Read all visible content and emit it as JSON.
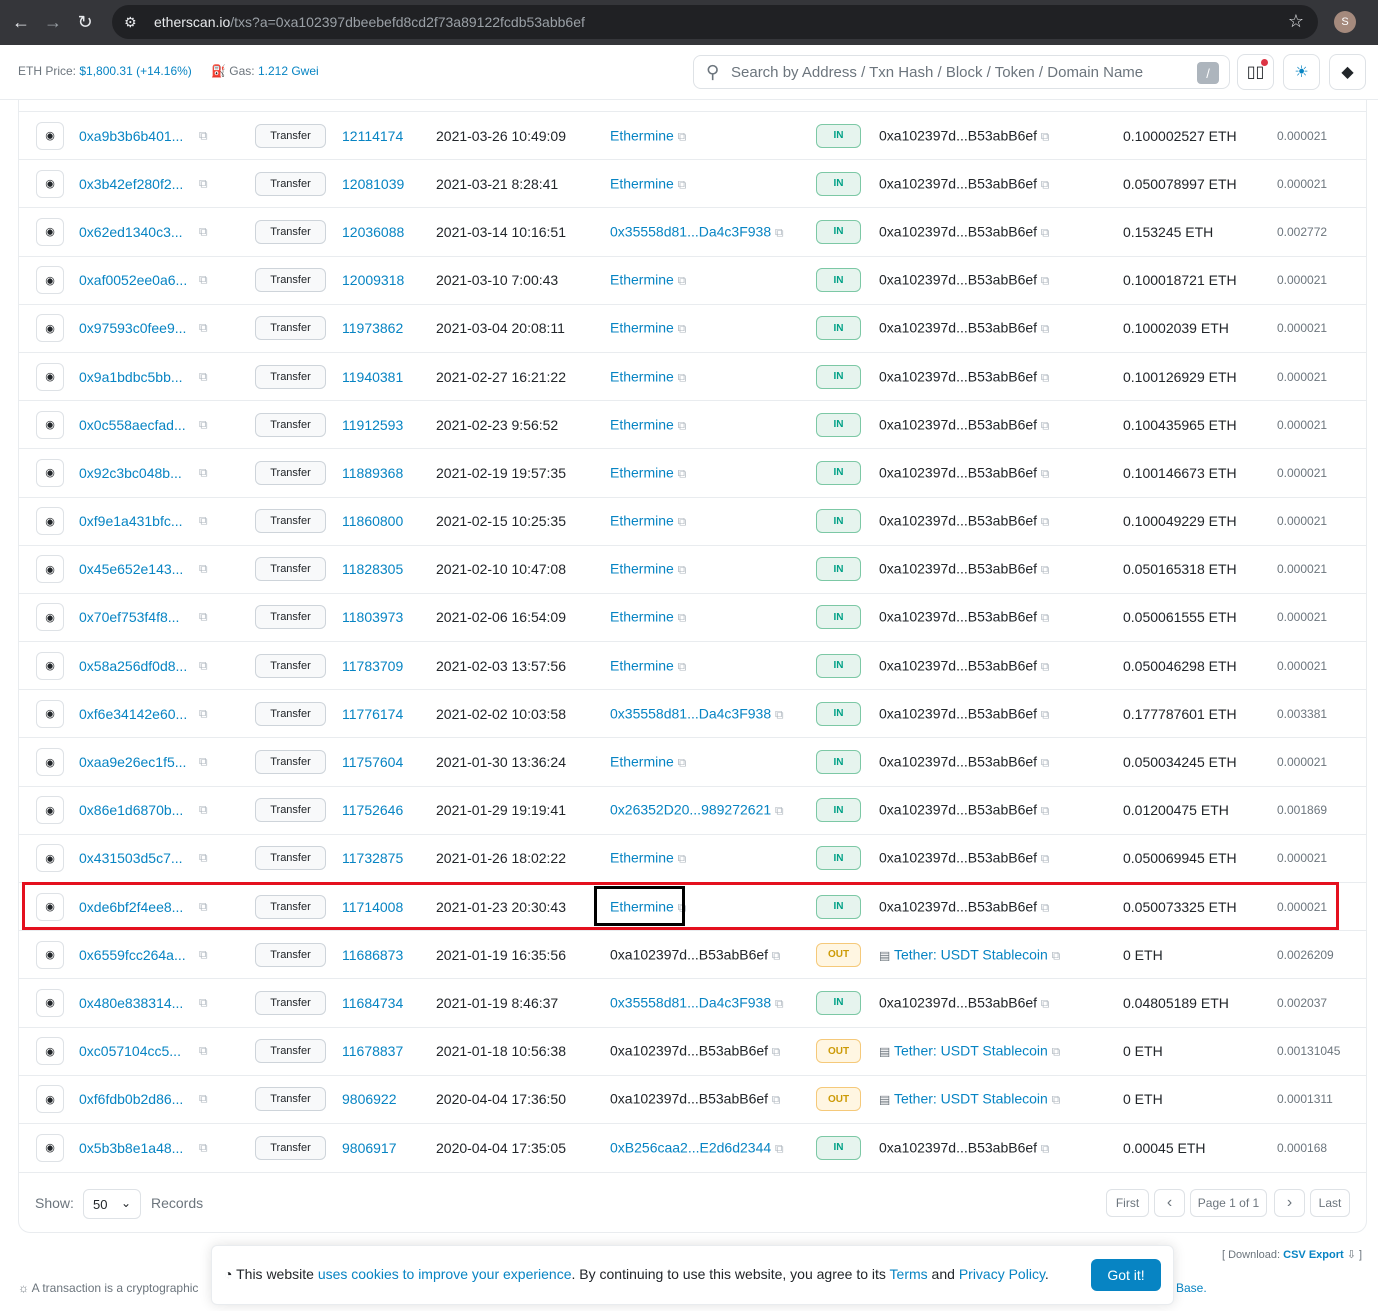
{
  "browser": {
    "url_host": "etherscan.io",
    "url_path": "/txs?a=0xa102397dbeebefd8cd2f73a89122fcdb53abb6ef",
    "profile_initial": "S"
  },
  "header": {
    "eth_price_label": "ETH Price:",
    "eth_price_value": "$1,800.31 (+14.16%)",
    "gas_label": "Gas:",
    "gas_value": "1.212 Gwei",
    "search_placeholder": "Search by Address / Txn Hash / Block / Token / Domain Name",
    "search_shortcut": "/"
  },
  "rows": [
    {
      "hash": "0xa9b3b6b401...",
      "method": "Transfer",
      "block": "12114174",
      "age": "2021-03-26 10:49:09",
      "from": "Ethermine",
      "from_link": true,
      "dir": "IN",
      "to": "0xa102397d...B53abB6ef",
      "to_link": false,
      "to_doc": false,
      "value": "0.100002527 ETH",
      "fee": "0.000021"
    },
    {
      "hash": "0x3b42ef280f2...",
      "method": "Transfer",
      "block": "12081039",
      "age": "2021-03-21 8:28:41",
      "from": "Ethermine",
      "from_link": true,
      "dir": "IN",
      "to": "0xa102397d...B53abB6ef",
      "to_link": false,
      "to_doc": false,
      "value": "0.050078997 ETH",
      "fee": "0.000021"
    },
    {
      "hash": "0x62ed1340c3...",
      "method": "Transfer",
      "block": "12036088",
      "age": "2021-03-14 10:16:51",
      "from": "0x35558d81...Da4c3F938",
      "from_link": true,
      "dir": "IN",
      "to": "0xa102397d...B53abB6ef",
      "to_link": false,
      "to_doc": false,
      "value": "0.153245 ETH",
      "fee": "0.002772"
    },
    {
      "hash": "0xaf0052ee0a6...",
      "method": "Transfer",
      "block": "12009318",
      "age": "2021-03-10 7:00:43",
      "from": "Ethermine",
      "from_link": true,
      "dir": "IN",
      "to": "0xa102397d...B53abB6ef",
      "to_link": false,
      "to_doc": false,
      "value": "0.100018721 ETH",
      "fee": "0.000021"
    },
    {
      "hash": "0x97593c0fee9...",
      "method": "Transfer",
      "block": "11973862",
      "age": "2021-03-04 20:08:11",
      "from": "Ethermine",
      "from_link": true,
      "dir": "IN",
      "to": "0xa102397d...B53abB6ef",
      "to_link": false,
      "to_doc": false,
      "value": "0.10002039 ETH",
      "fee": "0.000021"
    },
    {
      "hash": "0x9a1bdbc5bb...",
      "method": "Transfer",
      "block": "11940381",
      "age": "2021-02-27 16:21:22",
      "from": "Ethermine",
      "from_link": true,
      "dir": "IN",
      "to": "0xa102397d...B53abB6ef",
      "to_link": false,
      "to_doc": false,
      "value": "0.100126929 ETH",
      "fee": "0.000021"
    },
    {
      "hash": "0x0c558aecfad...",
      "method": "Transfer",
      "block": "11912593",
      "age": "2021-02-23 9:56:52",
      "from": "Ethermine",
      "from_link": true,
      "dir": "IN",
      "to": "0xa102397d...B53abB6ef",
      "to_link": false,
      "to_doc": false,
      "value": "0.100435965 ETH",
      "fee": "0.000021"
    },
    {
      "hash": "0x92c3bc048b...",
      "method": "Transfer",
      "block": "11889368",
      "age": "2021-02-19 19:57:35",
      "from": "Ethermine",
      "from_link": true,
      "dir": "IN",
      "to": "0xa102397d...B53abB6ef",
      "to_link": false,
      "to_doc": false,
      "value": "0.100146673 ETH",
      "fee": "0.000021"
    },
    {
      "hash": "0xf9e1a431bfc...",
      "method": "Transfer",
      "block": "11860800",
      "age": "2021-02-15 10:25:35",
      "from": "Ethermine",
      "from_link": true,
      "dir": "IN",
      "to": "0xa102397d...B53abB6ef",
      "to_link": false,
      "to_doc": false,
      "value": "0.100049229 ETH",
      "fee": "0.000021"
    },
    {
      "hash": "0x45e652e143...",
      "method": "Transfer",
      "block": "11828305",
      "age": "2021-02-10 10:47:08",
      "from": "Ethermine",
      "from_link": true,
      "dir": "IN",
      "to": "0xa102397d...B53abB6ef",
      "to_link": false,
      "to_doc": false,
      "value": "0.050165318 ETH",
      "fee": "0.000021"
    },
    {
      "hash": "0x70ef753f4f8...",
      "method": "Transfer",
      "block": "11803973",
      "age": "2021-02-06 16:54:09",
      "from": "Ethermine",
      "from_link": true,
      "dir": "IN",
      "to": "0xa102397d...B53abB6ef",
      "to_link": false,
      "to_doc": false,
      "value": "0.050061555 ETH",
      "fee": "0.000021"
    },
    {
      "hash": "0x58a256df0d8...",
      "method": "Transfer",
      "block": "11783709",
      "age": "2021-02-03 13:57:56",
      "from": "Ethermine",
      "from_link": true,
      "dir": "IN",
      "to": "0xa102397d...B53abB6ef",
      "to_link": false,
      "to_doc": false,
      "value": "0.050046298 ETH",
      "fee": "0.000021"
    },
    {
      "hash": "0xf6e34142e60...",
      "method": "Transfer",
      "block": "11776174",
      "age": "2021-02-02 10:03:58",
      "from": "0x35558d81...Da4c3F938",
      "from_link": true,
      "dir": "IN",
      "to": "0xa102397d...B53abB6ef",
      "to_link": false,
      "to_doc": false,
      "value": "0.177787601 ETH",
      "fee": "0.003381"
    },
    {
      "hash": "0xaa9e26ec1f5...",
      "method": "Transfer",
      "block": "11757604",
      "age": "2021-01-30 13:36:24",
      "from": "Ethermine",
      "from_link": true,
      "dir": "IN",
      "to": "0xa102397d...B53abB6ef",
      "to_link": false,
      "to_doc": false,
      "value": "0.050034245 ETH",
      "fee": "0.000021"
    },
    {
      "hash": "0x86e1d6870b...",
      "method": "Transfer",
      "block": "11752646",
      "age": "2021-01-29 19:19:41",
      "from": "0x26352D20...989272621",
      "from_link": true,
      "dir": "IN",
      "to": "0xa102397d...B53abB6ef",
      "to_link": false,
      "to_doc": false,
      "value": "0.01200475 ETH",
      "fee": "0.001869"
    },
    {
      "hash": "0x431503d5c7...",
      "method": "Transfer",
      "block": "11732875",
      "age": "2021-01-26 18:02:22",
      "from": "Ethermine",
      "from_link": true,
      "dir": "IN",
      "to": "0xa102397d...B53abB6ef",
      "to_link": false,
      "to_doc": false,
      "value": "0.050069945 ETH",
      "fee": "0.000021"
    },
    {
      "hash": "0xde6bf2f4ee8...",
      "method": "Transfer",
      "block": "11714008",
      "age": "2021-01-23 20:30:43",
      "from": "Ethermine",
      "from_link": true,
      "dir": "IN",
      "to": "0xa102397d...B53abB6ef",
      "to_link": false,
      "to_doc": false,
      "value": "0.050073325 ETH",
      "fee": "0.000021"
    },
    {
      "hash": "0x6559fcc264a...",
      "method": "Transfer",
      "block": "11686873",
      "age": "2021-01-19 16:35:56",
      "from": "0xa102397d...B53abB6ef",
      "from_link": false,
      "dir": "OUT",
      "to": "Tether: USDT Stablecoin",
      "to_link": true,
      "to_doc": true,
      "value": "0 ETH",
      "fee": "0.0026209"
    },
    {
      "hash": "0x480e838314...",
      "method": "Transfer",
      "block": "11684734",
      "age": "2021-01-19 8:46:37",
      "from": "0x35558d81...Da4c3F938",
      "from_link": true,
      "dir": "IN",
      "to": "0xa102397d...B53abB6ef",
      "to_link": false,
      "to_doc": false,
      "value": "0.04805189 ETH",
      "fee": "0.002037"
    },
    {
      "hash": "0xc057104cc5...",
      "method": "Transfer",
      "block": "11678837",
      "age": "2021-01-18 10:56:38",
      "from": "0xa102397d...B53abB6ef",
      "from_link": false,
      "dir": "OUT",
      "to": "Tether: USDT Stablecoin",
      "to_link": true,
      "to_doc": true,
      "value": "0 ETH",
      "fee": "0.00131045"
    },
    {
      "hash": "0xf6fdb0b2d86...",
      "method": "Transfer",
      "block": "9806922",
      "age": "2020-04-04 17:36:50",
      "from": "0xa102397d...B53abB6ef",
      "from_link": false,
      "dir": "OUT",
      "to": "Tether: USDT Stablecoin",
      "to_link": true,
      "to_doc": true,
      "value": "0 ETH",
      "fee": "0.0001311"
    },
    {
      "hash": "0x5b3b8e1a48...",
      "method": "Transfer",
      "block": "9806917",
      "age": "2020-04-04 17:35:05",
      "from": "0xB256caa2...E2d6d2344",
      "from_link": true,
      "dir": "IN",
      "to": "0xa102397d...B53abB6ef",
      "to_link": false,
      "to_doc": false,
      "value": "0.00045 ETH",
      "fee": "0.000168"
    }
  ],
  "pager": {
    "show_label": "Show:",
    "page_size": "50",
    "records_label": "Records",
    "first": "First",
    "prev": "‹",
    "page_info": "Page 1 of 1",
    "next": "›",
    "last": "Last"
  },
  "download": {
    "prefix": "[ Download:",
    "link": "CSV Export",
    "suffix": "]"
  },
  "tip_text": "A transaction is a cryptographic",
  "base_text": "Base.",
  "cookie": {
    "t1": "This website ",
    "l1": "uses cookies to improve your experience",
    "t2": ". By continuing to use this website, you agree to its ",
    "l2": "Terms",
    "t3": " and ",
    "l3": "Privacy Policy",
    "t4": ".",
    "button": "Got it!"
  },
  "colors": {
    "link": "#0784c3",
    "highlight": "#e4101e",
    "in_badge": "#00a186",
    "out_badge": "#cc9a06"
  }
}
